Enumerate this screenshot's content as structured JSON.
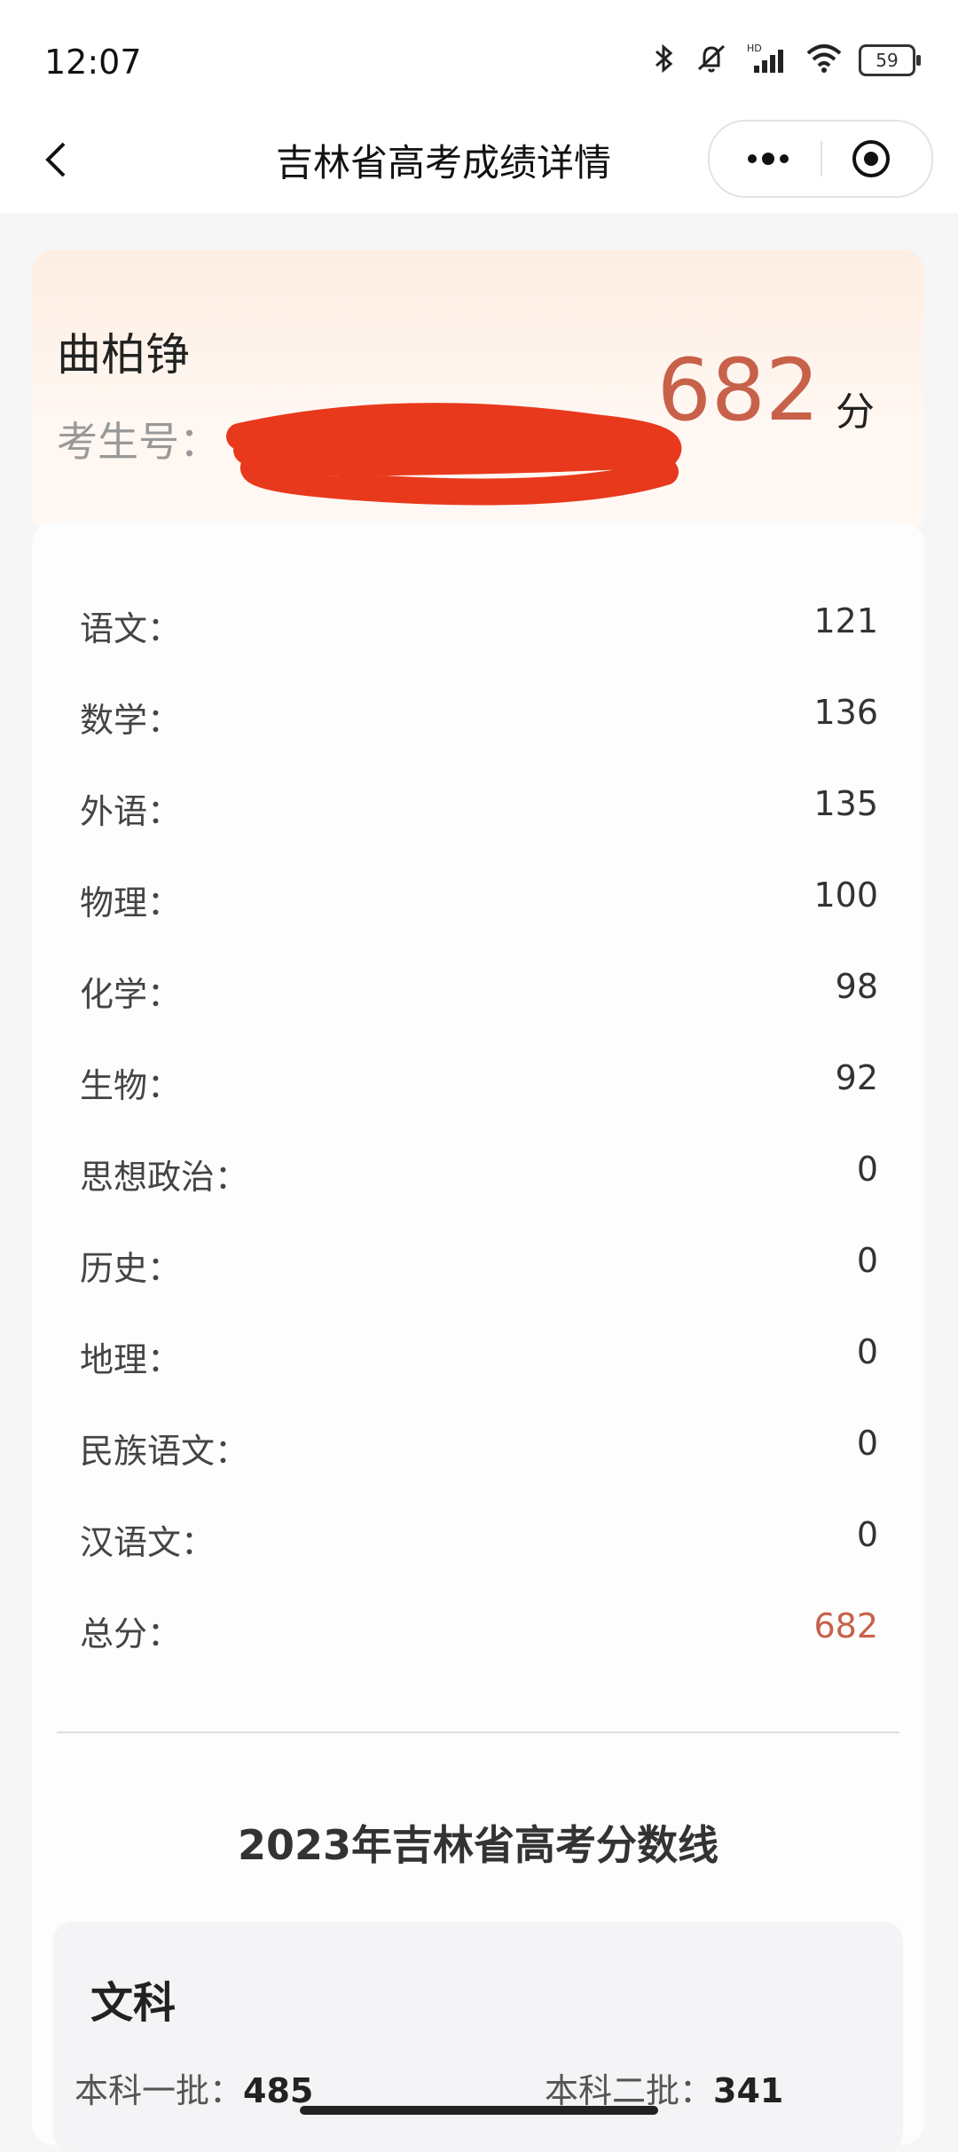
{
  "status_bar": {
    "time": "12:07",
    "battery": "59",
    "icons": [
      "bluetooth-icon",
      "mute-icon",
      "hd-signal-icon",
      "wifi-icon",
      "battery-icon"
    ]
  },
  "nav": {
    "title": "吉林省高考成绩详情",
    "icons": [
      "back-arrow-icon",
      "more-dots-icon",
      "target-circle-icon"
    ]
  },
  "student": {
    "name": "曲柏铮",
    "exam_id_label": "考生号：",
    "total_score": "682",
    "score_unit": "分"
  },
  "subjects": [
    {
      "label": "语文：",
      "score": "121"
    },
    {
      "label": "数学：",
      "score": "136"
    },
    {
      "label": "外语：",
      "score": "135"
    },
    {
      "label": "物理：",
      "score": "100"
    },
    {
      "label": "化学：",
      "score": "98"
    },
    {
      "label": "生物：",
      "score": "92"
    },
    {
      "label": "思想政治：",
      "score": "0"
    },
    {
      "label": "历史：",
      "score": "0"
    },
    {
      "label": "地理：",
      "score": "0"
    },
    {
      "label": "民族语文：",
      "score": "0"
    },
    {
      "label": "汉语文：",
      "score": "0"
    },
    {
      "label": "总分：",
      "score": "682"
    }
  ],
  "score_lines": {
    "title": "2023年吉林省高考分数线",
    "category": "文科",
    "batch1_label": "本科一批：",
    "batch1_score": "485",
    "batch2_label": "本科二批：",
    "batch2_score": "341"
  },
  "colors": {
    "accent": "#c8614a",
    "redaction": "#e8391c"
  }
}
